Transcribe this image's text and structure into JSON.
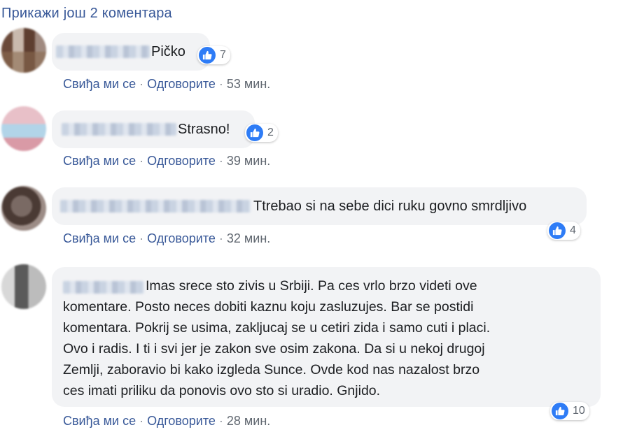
{
  "more_comments": "Прикажи још 2 коментара",
  "actions": {
    "like": "Свиђа ми се",
    "reply": "Одговорите",
    "separator": "·"
  },
  "comments": [
    {
      "text": "Pičko",
      "likes": "7",
      "time": "53 мин."
    },
    {
      "text": "Strasno!",
      "likes": "2",
      "time": "39 мин."
    },
    {
      "text": "Ttrebao si na sebe dici ruku govno smrdljivo",
      "likes": "4",
      "time": "32 мин."
    },
    {
      "lines": [
        "Imas srece sto zivis u Srbiji. Pa ces vrlo brzo videti ove",
        "komentare. Posto neces dobiti kaznu koju zasluzujes. Bar se postidi",
        "komentara. Pokrij se usima, zakljucaj se u cetiri zida i samo cuti i placi.",
        "Ovo i radis. I ti i svi jer je zakon sve osim zakona. Da si u nekoj drugoj",
        "Zemlji, zaboravio bi kako izgleda Sunce. Ovde kod nas nazalost brzo",
        "ces imati priliku da ponovis ovo sto si uradio. Gnjido."
      ],
      "likes": "10",
      "time": "28 мин."
    }
  ],
  "colors": {
    "link": "#385898",
    "meta": "#606770",
    "bubble": "#f2f3f5",
    "like": "#2e7cf6"
  },
  "icons": {
    "like": "thumbs-up-icon"
  }
}
